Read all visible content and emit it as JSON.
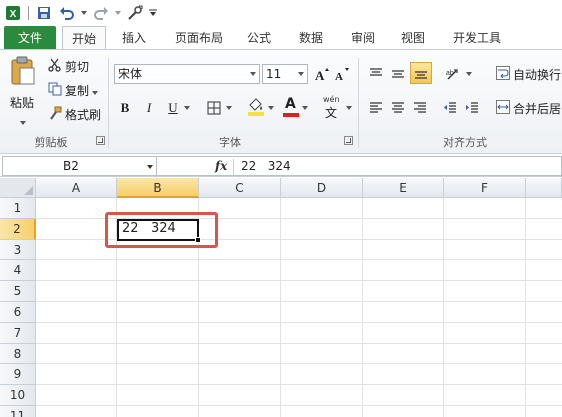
{
  "quick_access": {
    "icons": [
      "excel-logo-icon",
      "save-icon",
      "undo-icon",
      "redo-icon",
      "customize-icon"
    ]
  },
  "tabs": {
    "file": "文件",
    "home": "开始",
    "insert": "插入",
    "page_layout": "页面布局",
    "formulas": "公式",
    "data": "数据",
    "review": "审阅",
    "view": "视图",
    "developer": "开发工具"
  },
  "ribbon": {
    "clipboard": {
      "paste": "粘贴",
      "cut": "剪切",
      "copy": "复制",
      "format_painter": "格式刷",
      "group_label": "剪贴板"
    },
    "font": {
      "font_name": "宋体",
      "font_size": "11",
      "bold": "B",
      "italic": "I",
      "underline": "U",
      "font_color_letter": "A",
      "wen": "wén",
      "wen_char": "文",
      "group_label": "字体"
    },
    "alignment": {
      "wrap_text": "自动换行",
      "merge_center": "合并后居",
      "group_label": "对齐方式"
    }
  },
  "formula_bar": {
    "name_box": "B2",
    "fx": "fx",
    "content": "22   324"
  },
  "grid": {
    "columns": [
      "A",
      "B",
      "C",
      "D",
      "E",
      "F"
    ],
    "rows": [
      "1",
      "2",
      "3",
      "4",
      "5",
      "6",
      "7",
      "8",
      "9",
      "10",
      "11"
    ],
    "selected_column": "B",
    "selected_row": "2",
    "active_cell_value": "22   324"
  },
  "colors": {
    "file_tab": "#2a8a3e",
    "selection_header": "#f7cf6a",
    "highlight_box": "#d9534f"
  }
}
